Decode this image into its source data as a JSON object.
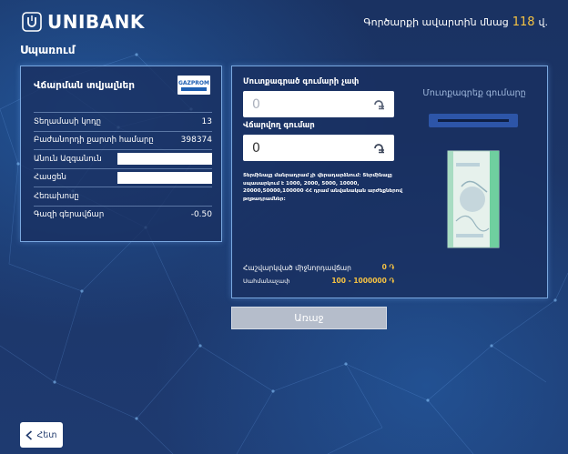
{
  "header": {
    "brand": "UNIBANK",
    "timer_label": "Գործարքի ավարտին մնաց",
    "timer_value": "118",
    "timer_unit": "վ."
  },
  "page_title": "Սպառում",
  "payment_info": {
    "title": "Վճարման տվյալներ",
    "provider_logo_text": "GAZPROM",
    "rows": [
      {
        "label": "Տեղամասի կոդը",
        "value": "13"
      },
      {
        "label": "Բաժանորդի քարտի համարը",
        "value": "398374"
      },
      {
        "label": "Անուն Ազգանուն",
        "value": ""
      },
      {
        "label": "Հասցեն",
        "value": ""
      },
      {
        "label": "Հեռախոսը",
        "value": ""
      },
      {
        "label": "Գազի գերավճար",
        "value": "-0.50"
      }
    ]
  },
  "payment_form": {
    "entered_label": "Մուտքագրած գումարի չափ",
    "entered_value": "0",
    "pay_label": "Վճարվող գումար",
    "pay_value": "0",
    "note": "Տերմինալը մանրադրամ չի վերադարձնում: Տերմինալը սպասարկում է 1000, 2000, 5000, 10000, 20000,50000,100000 ՀՀ դրամ անվանական արժեքներով թղթադրամներ:",
    "commission_label": "Հաշվարկված միջնորդավճար",
    "commission_value": "0",
    "limit_label": "Սահմանաչափ",
    "limit_value": "100 - 1000000",
    "insert_label": "Մուտքագրեք գումարը"
  },
  "buttons": {
    "next": "Առաջ",
    "back": "Հետ"
  },
  "colors": {
    "accent": "#f6c343",
    "background": "#1c3566",
    "panel_border": "#7aa8e0",
    "next_button_disabled": "#b5bdcb"
  },
  "icons": {
    "dram": "dram-currency-icon",
    "back": "chevron-left-icon",
    "logo": "unibank-logo-icon"
  }
}
